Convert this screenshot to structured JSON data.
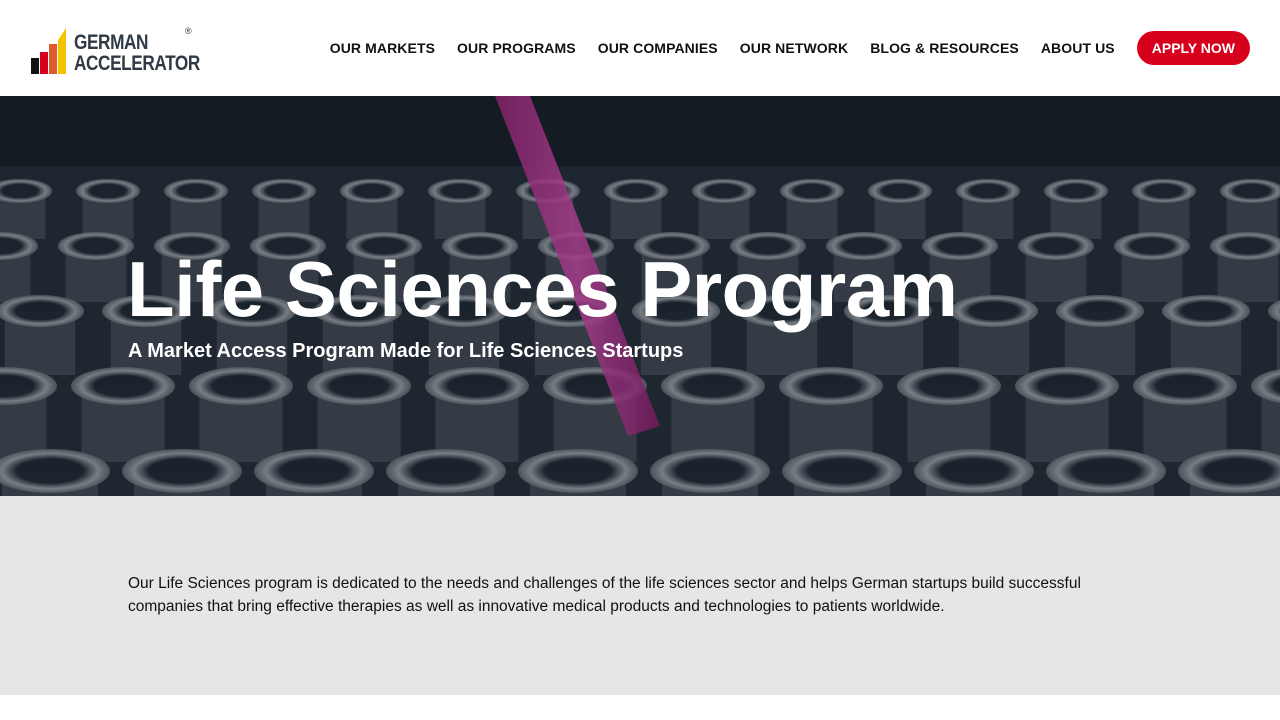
{
  "header": {
    "logo": {
      "line1": "GERMAN",
      "line2": "ACCELERATOR",
      "registered": "®",
      "bar_colors": [
        "#111111",
        "#d7001c",
        "#e05a2b",
        "#f5c400"
      ]
    },
    "nav": [
      {
        "label": "OUR MARKETS"
      },
      {
        "label": "OUR PROGRAMS"
      },
      {
        "label": "OUR COMPANIES"
      },
      {
        "label": "OUR NETWORK"
      },
      {
        "label": "BLOG & RESOURCES"
      },
      {
        "label": "ABOUT US"
      }
    ],
    "apply_label": "APPLY NOW",
    "accent_color": "#d7001c"
  },
  "hero": {
    "title": "Life Sciences Program",
    "subtitle": "A Market Access Program Made for Life Sciences Startups",
    "image": "laboratory-test-tubes-with-pink-pipette"
  },
  "intro": {
    "text": "Our Life Sciences program is dedicated to the needs and challenges of the life sciences sector and helps German startups build successful companies that bring effective therapies as well as innovative medical products and technologies to patients worldwide."
  }
}
